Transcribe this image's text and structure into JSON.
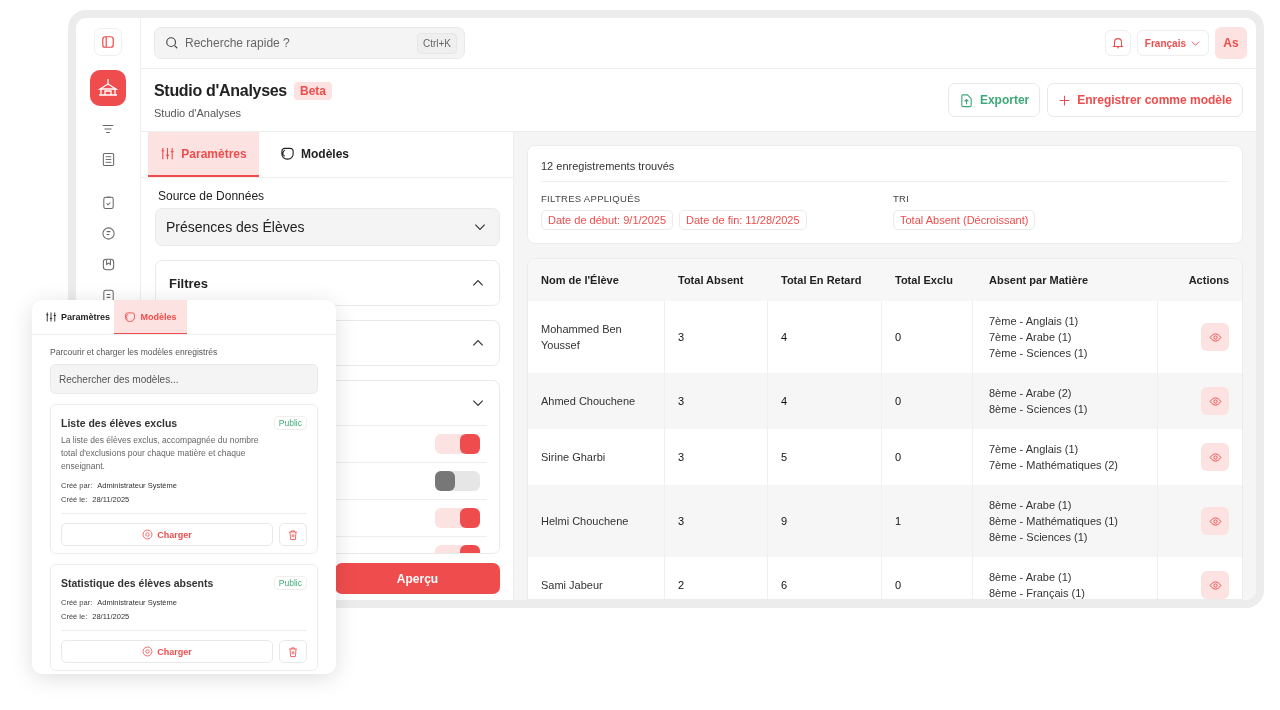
{
  "search": {
    "placeholder": "Recherche rapide ?",
    "shortcut": "Ctrl+K"
  },
  "topbar": {
    "language": "Français",
    "avatar": "As"
  },
  "header": {
    "title": "Studio d'Analyses",
    "badge": "Beta",
    "subtitle": "Studio d'Analyses"
  },
  "actions": [
    {
      "kind": "export",
      "label": "Exporter"
    },
    {
      "kind": "save",
      "label": "Enregistrer comme modèle"
    }
  ],
  "left_panel": {
    "tabs": [
      {
        "label": "Paramètres",
        "selected": true
      },
      {
        "label": "Modèles",
        "selected": false
      }
    ],
    "source": {
      "label": "Source de Données",
      "value": "Présences des Élèves"
    },
    "sections": [
      {
        "title": "Filtres",
        "expanded": true
      },
      {
        "expanded": true
      },
      {
        "expanded": false,
        "toggles": [
          {
            "on": true
          },
          {
            "on": false
          },
          {
            "on": true
          },
          {
            "on": true
          }
        ]
      }
    ],
    "preview_button": "Aperçu"
  },
  "results": {
    "count": "12 enregistrements trouvés",
    "filters_label": "FILTRES APPLIQUÉS",
    "filters": [
      "Date de début: 9/1/2025",
      "Date de fin: 11/28/2025"
    ],
    "sort_label": "TRI",
    "sort": [
      "Total Absent (Décroissant)"
    ]
  },
  "table": {
    "columns": [
      "Nom de l'Élève",
      "Total Absent",
      "Total En Retard",
      "Total Exclu",
      "Absent par Matière",
      "Actions"
    ],
    "rows": [
      {
        "name": "Mohammed Ben Youssef",
        "absent": "3",
        "late": "4",
        "excluded": "0",
        "subjects": [
          "7ème - Anglais (1)",
          "7ème - Arabe (1)",
          "7ème - Sciences (1)"
        ]
      },
      {
        "name": "Ahmed Chouchene",
        "absent": "3",
        "late": "4",
        "excluded": "0",
        "subjects": [
          "8ème - Arabe (2)",
          "8ème - Sciences (1)"
        ]
      },
      {
        "name": "Sirine Gharbi",
        "absent": "3",
        "late": "5",
        "excluded": "0",
        "subjects": [
          "7ème - Anglais (1)",
          "7ème - Mathématiques (2)"
        ]
      },
      {
        "name": "Helmi Chouchene",
        "absent": "3",
        "late": "9",
        "excluded": "1",
        "subjects": [
          "8ème - Arabe (1)",
          "8ème - Mathématiques (1)",
          "8ème - Sciences (1)"
        ]
      },
      {
        "name": "Sami Jabeur",
        "absent": "2",
        "late": "6",
        "excluded": "0",
        "subjects": [
          "8ème - Arabe (1)",
          "8ème - Français (1)"
        ]
      }
    ]
  },
  "overlay": {
    "tabs": [
      {
        "label": "Paramètres",
        "selected": false
      },
      {
        "label": "Modèles",
        "selected": true
      }
    ],
    "description": "Parcourir et charger les modèles enregistrés",
    "search_placeholder": "Rechercher des modèles...",
    "templates": [
      {
        "title": "Liste des élèves exclus",
        "visibility": "Public",
        "description": "La liste des élèves exclus, accompagnée du nombre total d'exclusions pour chaque matière et chaque enseignant.",
        "created_by_label": "Créé par:",
        "created_by": "Administrateur Système",
        "created_on_label": "Créé le:",
        "created_on": "28/11/2025",
        "load": "Charger"
      },
      {
        "title": "Statistique des élèves absents",
        "visibility": "Public",
        "created_by_label": "Créé par:",
        "created_by": "Administrateur Système",
        "created_on_label": "Créé le:",
        "created_on": "28/11/2025",
        "load": "Charger"
      }
    ]
  }
}
